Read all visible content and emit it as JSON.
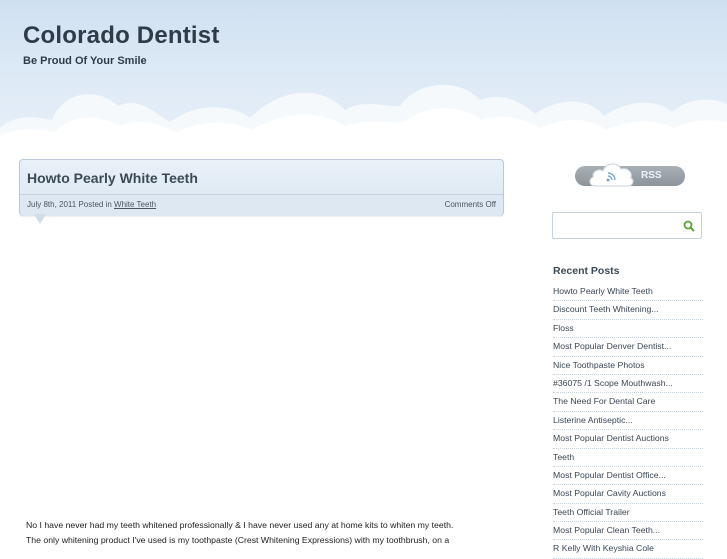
{
  "site": {
    "title": "Colorado Dentist",
    "tagline": "Be Proud Of Your Smile"
  },
  "post": {
    "title": "Howto Pearly White Teeth",
    "date": "July 8th, 2011 Posted in ",
    "category": "White Teeth",
    "comments": "Comments Off",
    "body_line1": "No I have never had my teeth whitened professionally & I have never used any at home kits to whiten my teeth.",
    "body_line2": "The only whitening product I've used is my toothpaste (Crest Whitening Expressions) with my toothbrush, on a"
  },
  "sidebar": {
    "rss_label": "RSS",
    "search_placeholder": "",
    "recent_heading": "Recent Posts",
    "recent_posts": [
      "Howto Pearly White Teeth",
      "Discount Teeth Whitening...",
      "Floss",
      "Most Popular Denver Dentist...",
      "Nice Toothpaste Photos",
      "#36075 /1 Scope Mouthwash...",
      "The Need For Dental Care",
      "Listerine Antiseptic...",
      "Most Popular Dentist Auctions",
      "Teeth",
      "Most Popular Dentist Office...",
      "Most Popular Cavity Auctions",
      "Teeth Official Trailer",
      "Most Popular Clean Teeth...",
      "R Kelly With Keyshia Cole"
    ]
  },
  "colors": {
    "sky": "#cfe0f1",
    "title_text": "#2f3b48",
    "search_icon": "#5aa532"
  },
  "icons": {
    "rss": "rss-cloud-icon",
    "search": "magnifier-icon"
  }
}
